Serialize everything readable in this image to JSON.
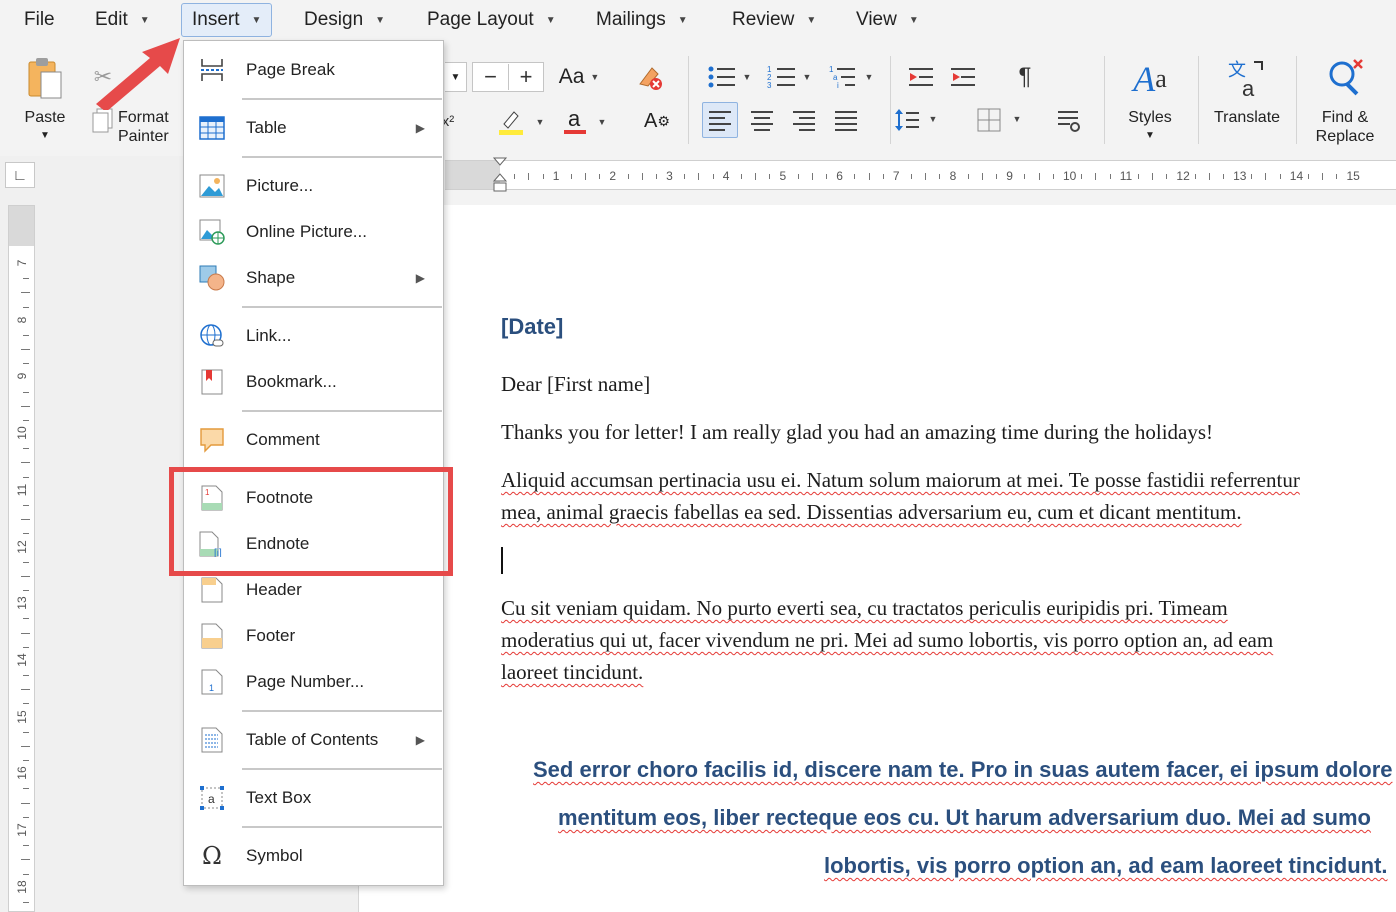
{
  "menubar": {
    "items": [
      {
        "label": "File",
        "has_caret": false
      },
      {
        "label": "Edit",
        "has_caret": true
      },
      {
        "label": "Insert",
        "has_caret": true,
        "active": true
      },
      {
        "label": "Design",
        "has_caret": true
      },
      {
        "label": "Page Layout",
        "has_caret": true
      },
      {
        "label": "Mailings",
        "has_caret": true
      },
      {
        "label": "Review",
        "has_caret": true
      },
      {
        "label": "View",
        "has_caret": true
      }
    ]
  },
  "ribbon": {
    "paste_label": "Paste",
    "format_painter_line1": "Format",
    "format_painter_line2": "Painter",
    "font_case_label": "Aa",
    "pilcrow": "¶",
    "styles_label": "Styles",
    "translate_label": "Translate",
    "find_replace_line1": "Find &",
    "find_replace_line2": "Replace",
    "superscript_glyph": "x²",
    "highlight_color": "#ffeb3b",
    "font_color": "#e53935"
  },
  "insert_menu": {
    "items": [
      {
        "label": "Page Break",
        "icon": "page-break-icon",
        "submenu": false
      },
      {
        "label": "Table",
        "icon": "table-icon",
        "submenu": true
      },
      {
        "label": "Picture...",
        "icon": "picture-icon",
        "submenu": false
      },
      {
        "label": "Online Picture...",
        "icon": "online-picture-icon",
        "submenu": false
      },
      {
        "label": "Shape",
        "icon": "shape-icon",
        "submenu": true
      },
      {
        "label": "Link...",
        "icon": "link-icon",
        "submenu": false
      },
      {
        "label": "Bookmark...",
        "icon": "bookmark-icon",
        "submenu": false
      },
      {
        "label": "Comment",
        "icon": "comment-icon",
        "submenu": false
      },
      {
        "label": "Footnote",
        "icon": "footnote-icon",
        "submenu": false
      },
      {
        "label": "Endnote",
        "icon": "endnote-icon",
        "submenu": false
      },
      {
        "label": "Header",
        "icon": "header-icon",
        "submenu": false
      },
      {
        "label": "Footer",
        "icon": "footer-icon",
        "submenu": false
      },
      {
        "label": "Page Number...",
        "icon": "page-number-icon",
        "submenu": false
      },
      {
        "label": "Table of Contents",
        "icon": "table-of-contents-icon",
        "submenu": true
      },
      {
        "label": "Text Box",
        "icon": "text-box-icon",
        "submenu": false
      },
      {
        "label": "Symbol",
        "icon": "symbol-icon",
        "submenu": false
      }
    ],
    "highlight_color": "#e64a4a",
    "arrow_color": "#e64a4a"
  },
  "rulers": {
    "horizontal_numbers": [
      "1",
      "2",
      "3",
      "4",
      "5",
      "6",
      "7",
      "8",
      "9",
      "10",
      "11",
      "12",
      "13",
      "14",
      "15"
    ],
    "vertical_numbers": [
      "7",
      "8",
      "9",
      "10",
      "11",
      "12",
      "13",
      "14",
      "15",
      "16",
      "17",
      "18"
    ]
  },
  "document": {
    "date_placeholder": "[Date]",
    "greeting": "Dear [First name]",
    "line1": "Thanks you for letter! I am really glad you had an amazing time during the holidays!",
    "para1_line1": "Aliquid accumsan pertinacia usu ei. Natum solum maiorum at mei. Te posse fastidii referrentur",
    "para1_line2": "mea, animal graecis fabellas ea sed. Dissentias adversarium eu, cum et dicant mentitum.",
    "para2_line1": "Cu sit veniam quidam. No purto everti sea, cu tractatos periculis euripidis pri. Timeam",
    "para2_line2": "moderatius qui ut, facer vivendum ne pri. Mei ad sumo lobortis, vis porro option an, ad eam",
    "para2_line3": "laoreet tincidunt.",
    "quote_line1": "Sed error choro facilis id, discere nam te. Pro in suas autem facer, ei ipsum dolore",
    "quote_line2": "mentitum eos, liber recteque eos cu. Ut harum adversarium duo. Mei ad sumo",
    "quote_line3": "lobortis, vis porro option an, ad eam laoreet tincidunt."
  }
}
